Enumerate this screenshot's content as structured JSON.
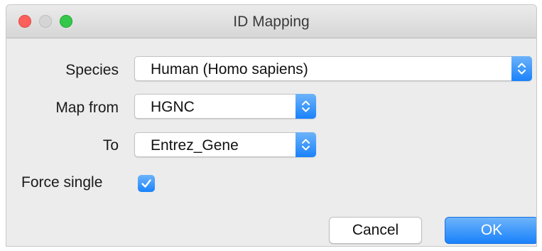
{
  "window": {
    "title": "ID Mapping",
    "buttons": [
      "close",
      "minimize",
      "zoom"
    ]
  },
  "form": {
    "species": {
      "label": "Species",
      "value": "Human (Homo sapiens)",
      "icon": "chevron-up-down-icon"
    },
    "map_from": {
      "label": "Map from",
      "value": "HGNC",
      "icon": "chevron-up-down-icon"
    },
    "to": {
      "label": "To",
      "value": "Entrez_Gene",
      "icon": "chevron-up-down-icon"
    },
    "force_single": {
      "label": "Force single",
      "checked": true,
      "icon": "checkmark-icon"
    }
  },
  "actions": {
    "cancel_label": "Cancel",
    "ok_label": "OK"
  },
  "colors": {
    "accent": "#1a82fb",
    "close": "#fc605b",
    "minimize_disabled": "#d5d5d5",
    "zoom": "#34c84a"
  }
}
